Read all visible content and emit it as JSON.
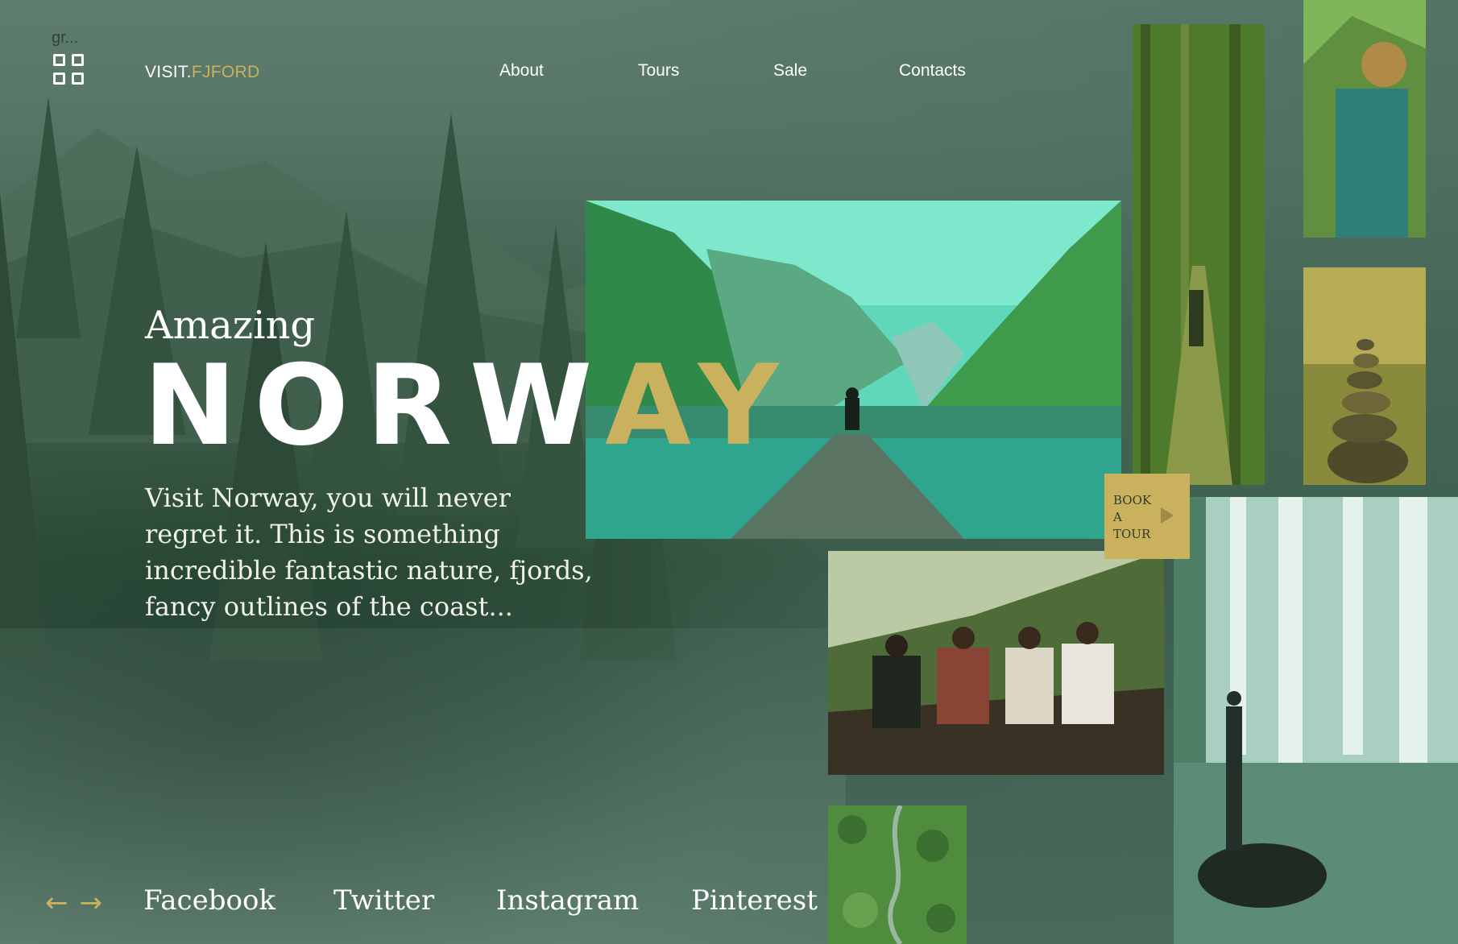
{
  "header": {
    "caption": "gr...",
    "brand_prefix": "VISIT.",
    "brand_accent": "FJFORD",
    "logo_icon": "grid-icon"
  },
  "nav": {
    "items": [
      {
        "label": "About"
      },
      {
        "label": "Tours"
      },
      {
        "label": "Sale"
      },
      {
        "label": "Contacts"
      }
    ]
  },
  "hero": {
    "subtitle": "Amazing",
    "title_white": "NORW",
    "title_gold": "AY",
    "description": "Visit Norway, you will never regret it. This is something incredible fantastic nature, fjords, fancy outlines of the coast..."
  },
  "cta": {
    "book_line1": "BOOK",
    "book_line2": "A",
    "book_line3": "TOUR",
    "icon": "play-arrow-icon"
  },
  "footer": {
    "prev_icon": "arrow-left-icon",
    "next_icon": "arrow-right-icon",
    "prev_glyph": "←",
    "next_glyph": "→",
    "social": [
      {
        "label": "Facebook"
      },
      {
        "label": "Twitter"
      },
      {
        "label": "Instagram"
      },
      {
        "label": "Pinterest"
      }
    ]
  },
  "colors": {
    "accent": "#c9b15e",
    "background": "#3e5e4f",
    "text": "#ffffff"
  }
}
